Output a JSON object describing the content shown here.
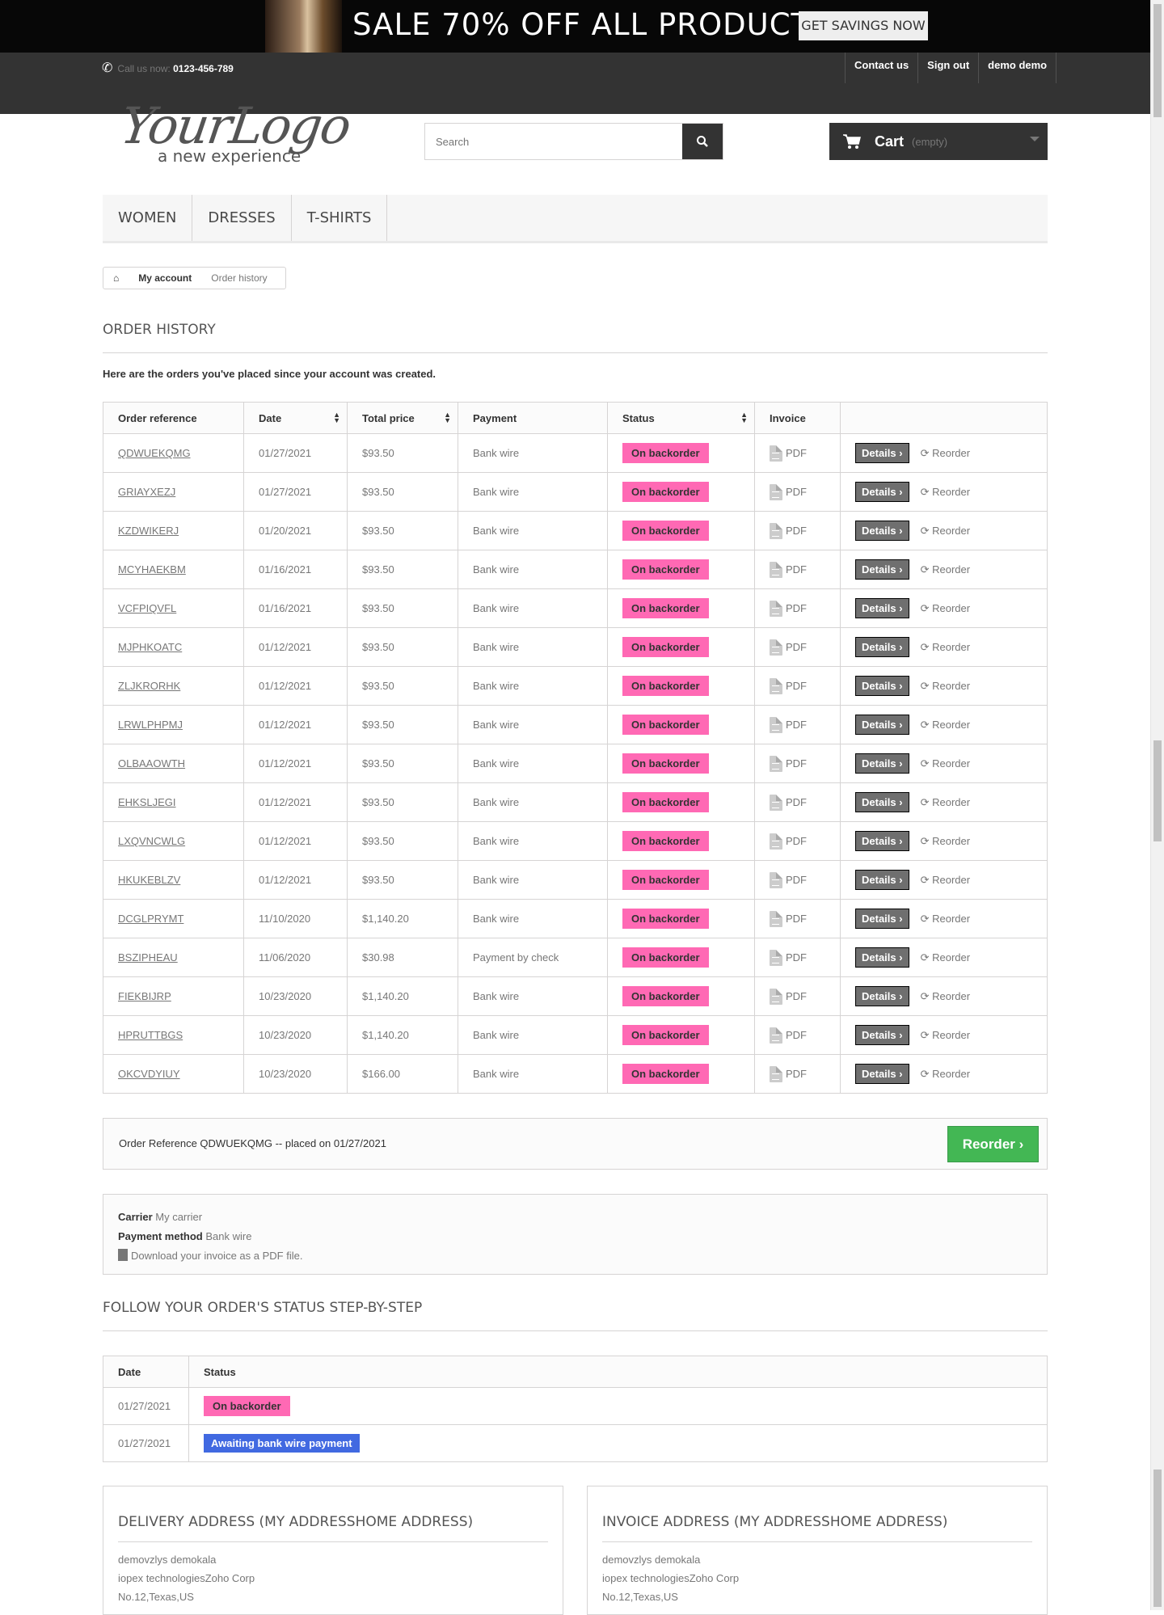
{
  "banner": {
    "text": "SALE 70% OFF ALL PRODUCTS",
    "cta": "GET SAVINGS NOW"
  },
  "topbar": {
    "call_label": "Call us now:",
    "phone": "0123-456-789",
    "links": [
      "Contact us",
      "Sign out",
      "demo demo"
    ]
  },
  "logo": {
    "main": "YourLogo",
    "tagline": "a new experience"
  },
  "search": {
    "placeholder": "Search"
  },
  "cart": {
    "label": "Cart",
    "status": "(empty)"
  },
  "menu": [
    "Women",
    "Dresses",
    "T-shirts"
  ],
  "breadcrumb": {
    "parent": "My account",
    "current": "Order history"
  },
  "page": {
    "title": "Order history",
    "intro": "Here are the orders you've placed since your account was created."
  },
  "table": {
    "headers": [
      "Order reference",
      "Date",
      "Total price",
      "Payment",
      "Status",
      "Invoice"
    ],
    "pdf_label": "PDF",
    "details_label": "Details",
    "reorder_label": "Reorder",
    "rows": [
      {
        "ref": "QDWUEKQMG",
        "date": "01/27/2021",
        "price": "$93.50",
        "payment": "Bank wire",
        "status": "On backorder"
      },
      {
        "ref": "GRIAYXEZJ",
        "date": "01/27/2021",
        "price": "$93.50",
        "payment": "Bank wire",
        "status": "On backorder"
      },
      {
        "ref": "KZDWIKERJ",
        "date": "01/20/2021",
        "price": "$93.50",
        "payment": "Bank wire",
        "status": "On backorder"
      },
      {
        "ref": "MCYHAEKBM",
        "date": "01/16/2021",
        "price": "$93.50",
        "payment": "Bank wire",
        "status": "On backorder"
      },
      {
        "ref": "VCFPIQVFL",
        "date": "01/16/2021",
        "price": "$93.50",
        "payment": "Bank wire",
        "status": "On backorder"
      },
      {
        "ref": "MJPHKOATC",
        "date": "01/12/2021",
        "price": "$93.50",
        "payment": "Bank wire",
        "status": "On backorder"
      },
      {
        "ref": "ZLJKRORHK",
        "date": "01/12/2021",
        "price": "$93.50",
        "payment": "Bank wire",
        "status": "On backorder"
      },
      {
        "ref": "LRWLPHPMJ",
        "date": "01/12/2021",
        "price": "$93.50",
        "payment": "Bank wire",
        "status": "On backorder"
      },
      {
        "ref": "OLBAAOWTH",
        "date": "01/12/2021",
        "price": "$93.50",
        "payment": "Bank wire",
        "status": "On backorder"
      },
      {
        "ref": "EHKSLJEGI",
        "date": "01/12/2021",
        "price": "$93.50",
        "payment": "Bank wire",
        "status": "On backorder"
      },
      {
        "ref": "LXQVNCWLG",
        "date": "01/12/2021",
        "price": "$93.50",
        "payment": "Bank wire",
        "status": "On backorder"
      },
      {
        "ref": "HKUKEBLZV",
        "date": "01/12/2021",
        "price": "$93.50",
        "payment": "Bank wire",
        "status": "On backorder"
      },
      {
        "ref": "DCGLPRYMT",
        "date": "11/10/2020",
        "price": "$1,140.20",
        "payment": "Bank wire",
        "status": "On backorder"
      },
      {
        "ref": "BSZIPHEAU",
        "date": "11/06/2020",
        "price": "$30.98",
        "payment": "Payment by check",
        "status": "On backorder"
      },
      {
        "ref": "FIEKBIJRP",
        "date": "10/23/2020",
        "price": "$1,140.20",
        "payment": "Bank wire",
        "status": "On backorder"
      },
      {
        "ref": "HPRUTTBGS",
        "date": "10/23/2020",
        "price": "$1,140.20",
        "payment": "Bank wire",
        "status": "On backorder"
      },
      {
        "ref": "OKCVDYIUY",
        "date": "10/23/2020",
        "price": "$166.00",
        "payment": "Bank wire",
        "status": "On backorder"
      }
    ]
  },
  "order_detail": {
    "summary": "Order Reference QDWUEKQMG -- placed on 01/27/2021",
    "reorder_button": "Reorder",
    "carrier_label": "Carrier",
    "carrier": "My carrier",
    "payment_label": "Payment method",
    "payment": "Bank wire",
    "invoice_link": "Download your invoice as a PDF file."
  },
  "steps": {
    "title": "Follow your order's status step-by-step",
    "headers": [
      "Date",
      "Status"
    ],
    "rows": [
      {
        "date": "01/27/2021",
        "status": "On backorder",
        "color": "#ff69b4"
      },
      {
        "date": "01/27/2021",
        "status": "Awaiting bank wire payment",
        "color": "#4169e1"
      }
    ]
  },
  "addresses": [
    {
      "title": "Delivery address (My addresshome address)",
      "lines": [
        "demovzlys demokala",
        "iopex technologiesZoho Corp",
        "No.12,Texas,US"
      ]
    },
    {
      "title": "Invoice address (My addresshome address)",
      "lines": [
        "demovzlys demokala",
        "iopex technologiesZoho Corp",
        "No.12,Texas,US"
      ]
    }
  ],
  "colors": {
    "status_pink": "#ff69b4",
    "status_blue": "#4169e1",
    "reorder_green": "#43b754",
    "dark": "#333333"
  }
}
